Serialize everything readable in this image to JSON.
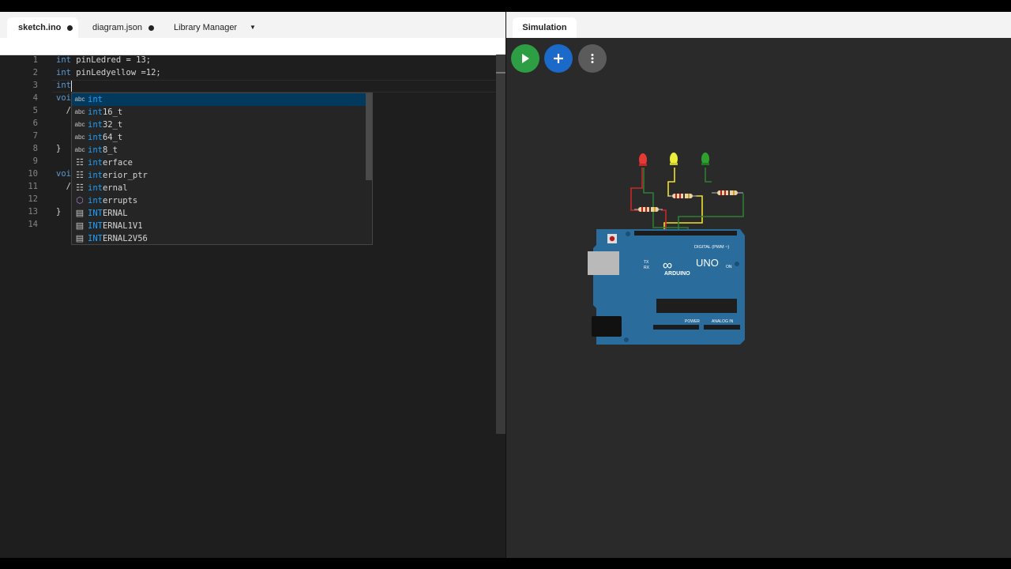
{
  "editor": {
    "tabs": [
      {
        "label": "sketch.ino",
        "modified": true
      },
      {
        "label": "diagram.json",
        "modified": true
      },
      {
        "label": "Library Manager"
      }
    ],
    "line_numbers": [
      "1",
      "2",
      "3",
      "4",
      "5",
      "6",
      "7",
      "8",
      "9",
      "10",
      "11",
      "12",
      "13",
      "14"
    ],
    "lines": [
      {
        "kw": "int",
        "rest": " pinLedred = 13;"
      },
      {
        "kw": "int",
        "rest": " pinLedyellow =12;"
      },
      {
        "kw": "int",
        "rest": ""
      },
      {
        "kw": "voi",
        "rest": ""
      },
      {
        "kw": "",
        "rest": "  /"
      },
      {
        "kw": "",
        "rest": ""
      },
      {
        "kw": "",
        "rest": ""
      },
      {
        "kw": "",
        "rest": "}"
      },
      {
        "kw": "",
        "rest": ""
      },
      {
        "kw": "voi",
        "rest": ""
      },
      {
        "kw": "",
        "rest": "  /"
      },
      {
        "kw": "",
        "rest": ""
      },
      {
        "kw": "",
        "rest": "}"
      },
      {
        "kw": "",
        "rest": ""
      }
    ]
  },
  "autocomplete": {
    "items": [
      {
        "icon": "abc",
        "match": "int",
        "rest": "",
        "selected": true
      },
      {
        "icon": "abc",
        "match": "int",
        "rest": "16_t"
      },
      {
        "icon": "abc",
        "match": "int",
        "rest": "32_t"
      },
      {
        "icon": "abc",
        "match": "int",
        "rest": "64_t"
      },
      {
        "icon": "abc",
        "match": "int",
        "rest": "8_t"
      },
      {
        "icon": "snippet",
        "match": "int",
        "rest": "erface"
      },
      {
        "icon": "snippet",
        "match": "int",
        "rest": "erior_ptr"
      },
      {
        "icon": "snippet",
        "match": "int",
        "rest": "ernal"
      },
      {
        "icon": "module",
        "match": "int",
        "rest": "errupts"
      },
      {
        "icon": "constant",
        "match": "INT",
        "rest": "ERNAL"
      },
      {
        "icon": "constant",
        "match": "INT",
        "rest": "ERNAL1V1"
      },
      {
        "icon": "constant",
        "match": "INT",
        "rest": "ERNAL2V56"
      }
    ]
  },
  "simulation": {
    "tab_label": "Simulation",
    "buttons": {
      "play": "play-icon",
      "add": "plus-icon",
      "more": "more-vertical-icon"
    },
    "leds": [
      {
        "color": "red",
        "hex": "#e53935"
      },
      {
        "color": "yellow",
        "hex": "#ecec3a"
      },
      {
        "color": "green",
        "hex": "#2fa12f"
      }
    ],
    "board": {
      "name": "UNO",
      "brand": "ARDUINO",
      "labels": {
        "digital": "DIGITAL (PWM ~)",
        "power": "POWER",
        "analog": "ANALOG IN",
        "tx": "TX",
        "rx": "RX",
        "on": "ON",
        "l": "L",
        "aref": "AREF",
        "gnd": "GND"
      },
      "color": "#2a6d9c"
    }
  },
  "colors": {
    "editor_bg": "#1e1e1e",
    "sim_bg": "#2a2a2a",
    "keyword": "#569cd6",
    "match": "#18a3ff",
    "selected": "#04395e"
  }
}
